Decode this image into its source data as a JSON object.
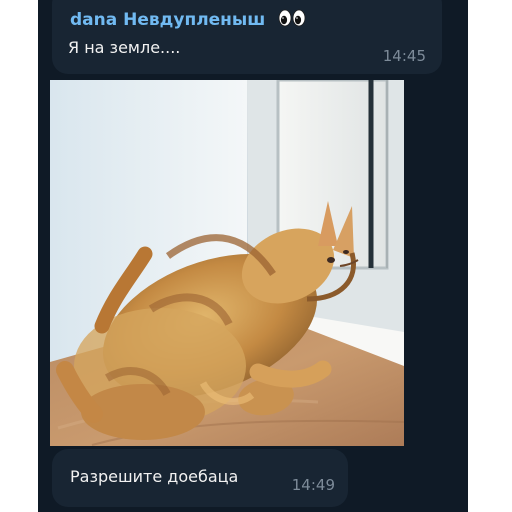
{
  "messages": [
    {
      "sender": "dana Невдупленыш",
      "sender_emoji": "eyes-icon",
      "text": "Я на земле....",
      "time": "14:45"
    },
    {
      "media_type": "video",
      "media_description_icon": "cat-lying-on-floor-image"
    },
    {
      "text": "Разрешите доебаца",
      "time": "14:49"
    }
  ],
  "colors": {
    "page_background": "#ffffff",
    "chat_background": "#0f1a26",
    "bubble_background": "#182533",
    "sender_name": "#71baf2",
    "message_text": "#f2f2f2",
    "timestamp": "#7d8b99"
  }
}
